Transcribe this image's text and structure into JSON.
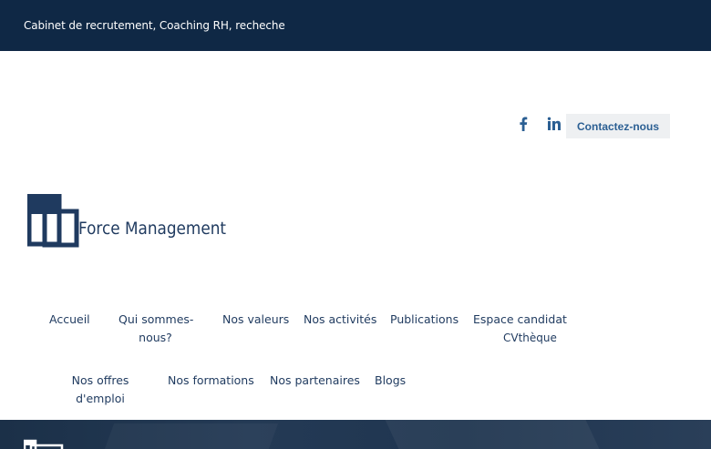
{
  "header": {
    "tagline": "Cabinet de recrutement, Coaching RH, recheche"
  },
  "social": {
    "facebook_icon": "facebook-icon",
    "linkedin_icon": "linkedin-icon"
  },
  "contact": {
    "label": "Contactez-nous"
  },
  "logo": {
    "text": "Force Management",
    "color": "#1f3a5f"
  },
  "nav": {
    "accueil": "Accueil",
    "qui_line1": "Qui sommes-",
    "qui_line2": "nous?",
    "valeurs": "Nos valeurs",
    "activites": "Nos activités",
    "publications": "Publications",
    "espace": "Espace candidat",
    "cvtheque": "CVthèque",
    "offres_line1": "Nos offres",
    "offres_line2": "d'emploi",
    "formations": "Nos formations",
    "partenaires": "Nos partenaires",
    "blogs": "Blogs"
  },
  "colors": {
    "topbar": "#0f2845",
    "brand": "#1f3a5f",
    "button_text": "#2b5f93",
    "button_bg": "#eef0f2"
  }
}
